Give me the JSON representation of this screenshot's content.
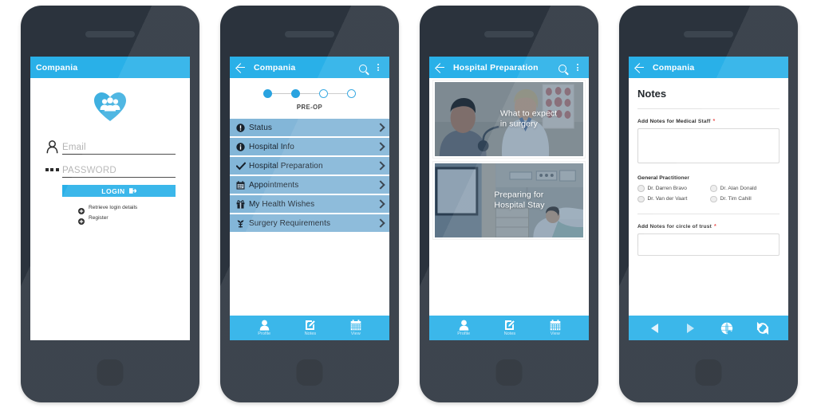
{
  "meta": {
    "accent_blue": "#29b0e8",
    "list_blue": "#83b6d8",
    "device_dark": "#2b333d",
    "required_red": "#e8423f"
  },
  "phone1": {
    "appbar": {
      "title": "Compania"
    },
    "logo_icon": "heart-people-icon",
    "fields": [
      {
        "icon": "user-icon",
        "placeholder": "Email"
      },
      {
        "icon": "password-dots-icon",
        "placeholder": "PASSWORD"
      }
    ],
    "login_button": {
      "label": "LOGIN",
      "icon": "login-arrow-icon"
    },
    "links": [
      {
        "icon": "plus-circle-icon",
        "label": "Retrieve login details"
      },
      {
        "icon": "plus-circle-icon",
        "label": "Register"
      }
    ]
  },
  "phone2": {
    "appbar": {
      "back_icon": "back-arrow-icon",
      "title": "Compania",
      "search_icon": "search-icon",
      "menu_icon": "overflow-menu-icon"
    },
    "stepper": {
      "total": 4,
      "completed": 2,
      "label": "PRE-OP"
    },
    "menu_items": [
      {
        "icon": "exclamation-circle-icon",
        "label": "Status"
      },
      {
        "icon": "info-circle-icon",
        "label": "Hospital Info"
      },
      {
        "icon": "check-icon",
        "label": "Hospital Preparation"
      },
      {
        "icon": "calendar-icon",
        "label": "Appointments"
      },
      {
        "icon": "gift-icon",
        "label": "My Health Wishes"
      },
      {
        "icon": "sprout-icon",
        "label": "Surgery Requirements"
      }
    ],
    "tabbar": [
      {
        "icon": "profile-person-icon",
        "label": "Profile"
      },
      {
        "icon": "notes-pencil-icon",
        "label": "Notes"
      },
      {
        "icon": "view-calendar-icon",
        "label": "View"
      }
    ]
  },
  "phone3": {
    "appbar": {
      "back_icon": "back-arrow-icon",
      "title": "Hospital Preparation",
      "search_icon": "search-icon",
      "menu_icon": "overflow-menu-icon"
    },
    "cards": [
      {
        "title": "What to expect\nin surgery",
        "image": "doctor-examining-patient-photo"
      },
      {
        "title": "Preparing for\nHospital Stay",
        "image": "hospital-room-patient-photo"
      }
    ],
    "tabbar": [
      {
        "icon": "profile-person-icon",
        "label": "Profile"
      },
      {
        "icon": "notes-pencil-icon",
        "label": "Notes"
      },
      {
        "icon": "view-calendar-icon",
        "label": "View"
      }
    ]
  },
  "phone4": {
    "appbar": {
      "back_icon": "back-arrow-icon",
      "title": "Compania"
    },
    "page_title": "Notes",
    "field1": {
      "label": "Add Notes for Medical Staff",
      "required": "*",
      "value": ""
    },
    "gp": {
      "title": "General Practitioner",
      "options": [
        "Dr. Darren Bravo",
        "Dr. Alan Donald",
        "Dr. Van der Vaart",
        "Dr. Tim Cahill"
      ]
    },
    "field2": {
      "label": "Add Notes for circle of trust",
      "required": "*",
      "value": ""
    },
    "navbar": [
      {
        "icon": "nav-back-icon"
      },
      {
        "icon": "nav-forward-icon"
      },
      {
        "icon": "globe-icon"
      },
      {
        "icon": "refresh-icon"
      }
    ]
  }
}
